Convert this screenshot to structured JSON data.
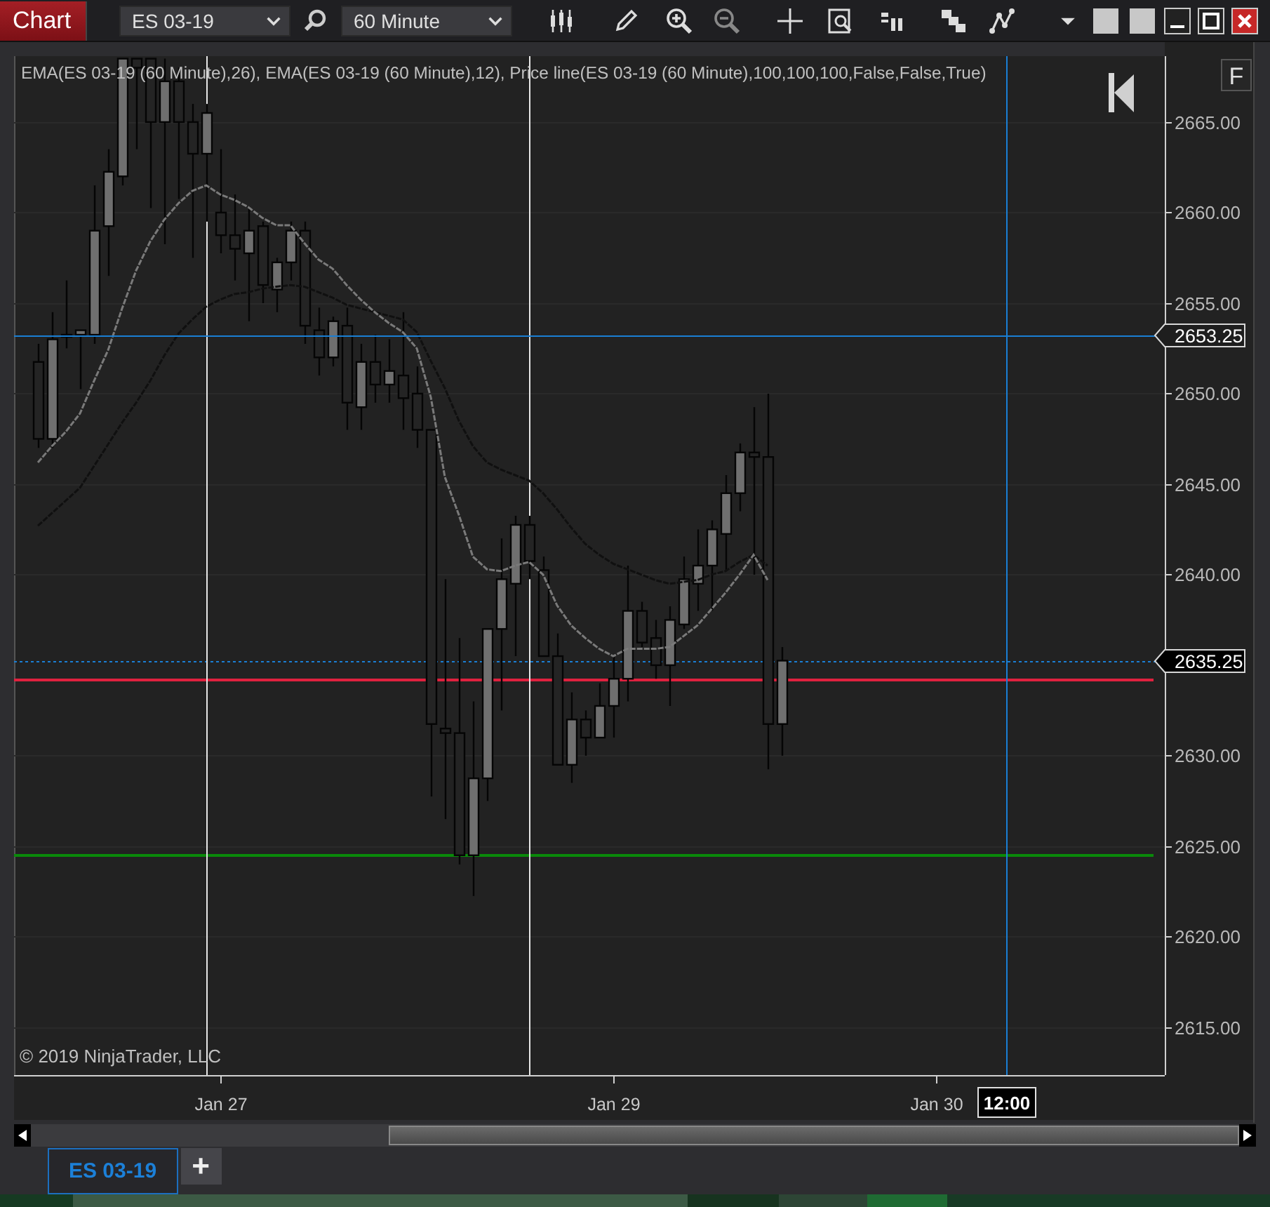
{
  "window": {
    "title": "Chart"
  },
  "toolbar": {
    "instrument": "ES 03-19",
    "interval": "60 Minute"
  },
  "chart": {
    "indicator_label": "EMA(ES 03-19 (60 Minute),26), EMA(ES 03-19 (60 Minute),12), Price line(ES 03-19 (60 Minute),100,100,100,False,False,True)",
    "f_button": "F",
    "copyright": "© 2019 NinjaTrader, LLC",
    "chart_data": {
      "type": "candlestick",
      "grid": true,
      "categories": [
        null,
        null,
        null,
        null,
        null,
        null,
        null,
        null,
        null,
        null,
        null,
        null,
        null,
        "Jan 27",
        null,
        null,
        null,
        null,
        null,
        null,
        null,
        null,
        null,
        null,
        null,
        null,
        null,
        null,
        null,
        null,
        null,
        null,
        null,
        null,
        null,
        null,
        null,
        null,
        null,
        null,
        null,
        "Jan 29",
        null,
        null,
        null,
        null,
        null,
        null,
        null,
        null,
        null,
        null,
        null,
        null,
        null,
        null,
        null,
        null,
        null,
        null,
        null,
        null,
        null,
        null,
        "Jan 30",
        null,
        null,
        null,
        null,
        null,
        null,
        null,
        null,
        null,
        null,
        null,
        null,
        null,
        null,
        null
      ],
      "ylim": [
        2612.36,
        2668.64
      ],
      "yticks": [
        {
          "value": 2665,
          "label": "2665.00"
        },
        {
          "value": 2660,
          "label": "2660.00"
        },
        {
          "value": 2655,
          "label": "2655.00"
        },
        {
          "value": 2650,
          "label": "2650.00"
        },
        {
          "value": 2645,
          "label": "2645.00"
        },
        {
          "value": 2640,
          "label": "2640.00"
        },
        {
          "value": 2630,
          "label": "2630.00"
        },
        {
          "value": 2625,
          "label": "2625.00"
        },
        {
          "value": 2620,
          "label": "2620.00"
        },
        {
          "value": 2615,
          "label": "2615.00"
        }
      ],
      "series": [
        {
          "type": "line",
          "color": "#101010",
          "line_style": "dashed",
          "values": [
            2642.7,
            2643.4,
            2644.1,
            2644.8,
            2646.0,
            2647.2,
            2648.4,
            2649.5,
            2650.7,
            2652.1,
            2653.3,
            2654.1,
            2654.8,
            2655.2,
            2655.5,
            2655.6,
            2655.8,
            2655.9,
            2656.0,
            2655.9,
            2655.6,
            2655.3,
            2654.9,
            2654.7,
            2654.5,
            2654.3,
            2654.1,
            2653.4,
            2651.8,
            2650.3,
            2648.5,
            2647.1,
            2646.2,
            2645.8,
            2645.5,
            2645.2,
            2644.5,
            2643.6,
            2642.6,
            2641.7,
            2641.1,
            2640.6,
            2640.3,
            2640.0,
            2639.7,
            2639.5,
            2639.6,
            2639.7,
            2640.0,
            2640.2,
            2640.7,
            2641.1,
            2640.5,
            null,
            null,
            null,
            null,
            null,
            null,
            null,
            null,
            null,
            null,
            null,
            null,
            null,
            null,
            null,
            null,
            null,
            null,
            null,
            null,
            null,
            null,
            null,
            null,
            null,
            null,
            null
          ]
        },
        {
          "type": "line",
          "color": "#7a7a7a",
          "line_style": "dashed",
          "values": [
            2646.2,
            2647.1,
            2647.9,
            2648.9,
            2650.7,
            2652.4,
            2654.7,
            2656.8,
            2658.4,
            2659.6,
            2660.5,
            2661.2,
            2661.5,
            2661.0,
            2660.7,
            2660.3,
            2659.7,
            2659.3,
            2659.3,
            2658.3,
            2657.4,
            2656.9,
            2656.0,
            2655.2,
            2654.5,
            2653.9,
            2653.4,
            2652.5,
            2649.8,
            2645.4,
            2643.3,
            2641.0,
            2640.3,
            2640.2,
            2640.5,
            2640.7,
            2640.0,
            2638.3,
            2637.2,
            2636.5,
            2635.9,
            2635.5,
            2635.9,
            2635.9,
            2635.9,
            2636.0,
            2636.6,
            2637.2,
            2638.1,
            2639.0,
            2640.0,
            2641.1,
            2639.7,
            null,
            null,
            null,
            null,
            null,
            null,
            null,
            null,
            null,
            null,
            null,
            null,
            null,
            null,
            null,
            null,
            null,
            null,
            null,
            null,
            null,
            null,
            null,
            null,
            null,
            null,
            null
          ]
        }
      ],
      "ohlc": [
        [
          2651.75,
          2652.75,
          2647,
          2647.5
        ],
        [
          2647.5,
          2654.5,
          2647,
          2653
        ],
        [
          2653.25,
          2656.25,
          2652.5,
          2653.25
        ],
        [
          2653.25,
          2653.5,
          2650.25,
          2653.5
        ],
        [
          2653.25,
          2661.5,
          2652.75,
          2659
        ],
        [
          2659.25,
          2663.5,
          2656.5,
          2662.25
        ],
        [
          2662,
          2668.5,
          2661.5,
          2668.5
        ],
        [
          2668.5,
          2668.5,
          2663.5,
          2668
        ],
        [
          2668.5,
          2668.5,
          2660.25,
          2665
        ],
        [
          2665,
          2668.5,
          2658.25,
          2667.25
        ],
        [
          2667.25,
          2668,
          2660.75,
          2665
        ],
        [
          2665,
          2666,
          2657.5,
          2663.25
        ],
        [
          2663.25,
          2666,
          2659.5,
          2665.5
        ],
        [
          2660,
          2663.5,
          2657.75,
          2658.75
        ],
        [
          2658.75,
          2661,
          2656.25,
          2658
        ],
        [
          2657.75,
          2660.25,
          2654,
          2659
        ],
        [
          2659.25,
          2659.5,
          2655,
          2656
        ],
        [
          2655.75,
          2657.5,
          2654.5,
          2657.25
        ],
        [
          2657.25,
          2659.5,
          2656.25,
          2659
        ],
        [
          2659,
          2659.5,
          2652.75,
          2653.75
        ],
        [
          2653.5,
          2654.75,
          2651,
          2652
        ],
        [
          2652,
          2654.25,
          2651.5,
          2654
        ],
        [
          2653.75,
          2654.75,
          2648,
          2649.5
        ],
        [
          2649.25,
          2652.75,
          2648,
          2651.75
        ],
        [
          2651.75,
          2653.25,
          2649.5,
          2650.5
        ],
        [
          2650.5,
          2653,
          2649.5,
          2651.25
        ],
        [
          2651,
          2654.5,
          2648,
          2649.75
        ],
        [
          2650,
          2651.5,
          2647,
          2648
        ],
        [
          2648,
          2648,
          2627.75,
          2631.75
        ],
        [
          2631.5,
          2639.75,
          2626.5,
          2631.25
        ],
        [
          2631.25,
          2636.5,
          2624,
          2624.5
        ],
        [
          2624.5,
          2633,
          2622.25,
          2628.75
        ],
        [
          2628.75,
          2637,
          2627.5,
          2637
        ],
        [
          2637,
          2642,
          2632.5,
          2639.75
        ],
        [
          2639.5,
          2643.25,
          2635.5,
          2642.75
        ],
        [
          2642.75,
          2643.25,
          2639.75,
          2640.75
        ],
        [
          2640.25,
          2641,
          2635.5,
          2635.5
        ],
        [
          2635.5,
          2636.75,
          2629.5,
          2629.5
        ],
        [
          2629.5,
          2633.5,
          2628.5,
          2632
        ],
        [
          2632,
          2632.5,
          2630,
          2631
        ],
        [
          2631,
          2634,
          2631,
          2632.75
        ],
        [
          2632.75,
          2635.5,
          2631,
          2634.25
        ],
        [
          2634.25,
          2640.5,
          2633,
          2638
        ],
        [
          2638,
          2638.5,
          2636,
          2636.25
        ],
        [
          2636.5,
          2637.5,
          2634.25,
          2635
        ],
        [
          2635,
          2638.25,
          2632.75,
          2637.5
        ],
        [
          2637.25,
          2641,
          2637,
          2639.75
        ],
        [
          2639.5,
          2642.5,
          2638,
          2640.5
        ],
        [
          2640.5,
          2643,
          2638,
          2642.5
        ],
        [
          2642.25,
          2645.5,
          2640.25,
          2644.5
        ],
        [
          2644.5,
          2647.25,
          2643.5,
          2646.75
        ],
        [
          2646.75,
          2649.25,
          2640,
          2646.5
        ],
        [
          2646.5,
          2650,
          2629.25,
          2631.75
        ],
        [
          2631.75,
          2636,
          2630,
          2635.25
        ],
        null,
        null,
        null,
        null,
        null,
        null,
        null,
        null,
        null,
        null,
        null,
        null,
        null,
        null,
        null,
        null,
        null,
        null,
        null,
        null,
        null,
        null,
        null,
        null,
        null,
        null
      ],
      "ref_lines": [
        {
          "axis": "y",
          "value": 2653.25,
          "color": "#1a7fd4",
          "label": "2653.25"
        },
        {
          "axis": "y",
          "value": 2635.25,
          "color": "#1a7fd4",
          "line_style": "dotted",
          "label": "2635.25"
        },
        {
          "axis": "y",
          "value": 2634.2,
          "color": "#e0213f"
        },
        {
          "axis": "y",
          "value": 2624.5,
          "color": "#0a8a0a"
        }
      ]
    },
    "time_marker": "12:00"
  },
  "tabs": [
    {
      "label": "ES 03-19",
      "selected": true
    }
  ],
  "add_tab": "+"
}
